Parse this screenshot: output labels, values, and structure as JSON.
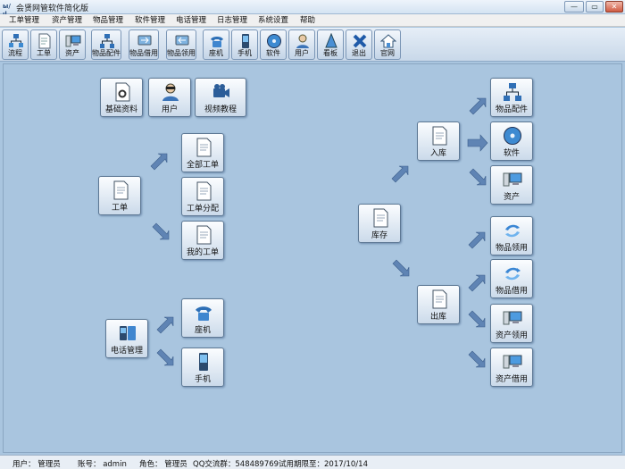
{
  "window": {
    "title": "会贤网管软件简化版",
    "app_icon_text": "ы/ıl",
    "min_glyph": "—",
    "max_glyph": "▭",
    "close_glyph": "✕"
  },
  "menu": [
    "工单管理",
    "资产管理",
    "物品管理",
    "软件管理",
    "电话管理",
    "日志管理",
    "系统设置",
    "帮助"
  ],
  "toolbar": [
    {
      "label": "流程",
      "icon": "flow-icon"
    },
    {
      "label": "工单",
      "icon": "document-icon"
    },
    {
      "label": "资产",
      "icon": "computer-icon"
    },
    {
      "label": "物品配件",
      "icon": "network-icon"
    },
    {
      "label": "物品借用",
      "icon": "item-borrow-icon"
    },
    {
      "label": "物品领用",
      "icon": "item-receive-icon"
    },
    {
      "label": "座机",
      "icon": "desk-phone-icon"
    },
    {
      "label": "手机",
      "icon": "mobile-phone-icon"
    },
    {
      "label": "软件",
      "icon": "cd-icon"
    },
    {
      "label": "用户",
      "icon": "user-icon"
    },
    {
      "label": "看板",
      "icon": "dashboard-icon"
    },
    {
      "label": "退出",
      "icon": "exit-icon"
    },
    {
      "label": "官网",
      "icon": "home-icon"
    }
  ],
  "tiles": {
    "basic_data": "基础资料",
    "user": "用户",
    "video_tutorial": "视频教程",
    "work_order": "工单",
    "all_work_orders": "全部工单",
    "work_order_assign": "工单分配",
    "my_work_orders": "我的工单",
    "phone_management": "电话管理",
    "desk_phone": "座机",
    "mobile_phone": "手机",
    "inventory": "库存",
    "stock_in": "入库",
    "stock_out": "出库",
    "item_parts": "物品配件",
    "software": "软件",
    "asset": "资产",
    "item_receive": "物品领用",
    "item_borrow": "物品借用",
    "asset_receive": "资产领用",
    "asset_borrow": "资产借用"
  },
  "status": {
    "user": "用户： 管理员",
    "account": "账号： admin",
    "role": "角色： 管理员",
    "qq": "QQ交流群：548489769",
    "trial": "试用期限至：2017/10/14"
  },
  "colors": {
    "canvas_bg": "#a9c5df",
    "arrow": "#5f84b4",
    "close_button": "#cf5a41"
  }
}
